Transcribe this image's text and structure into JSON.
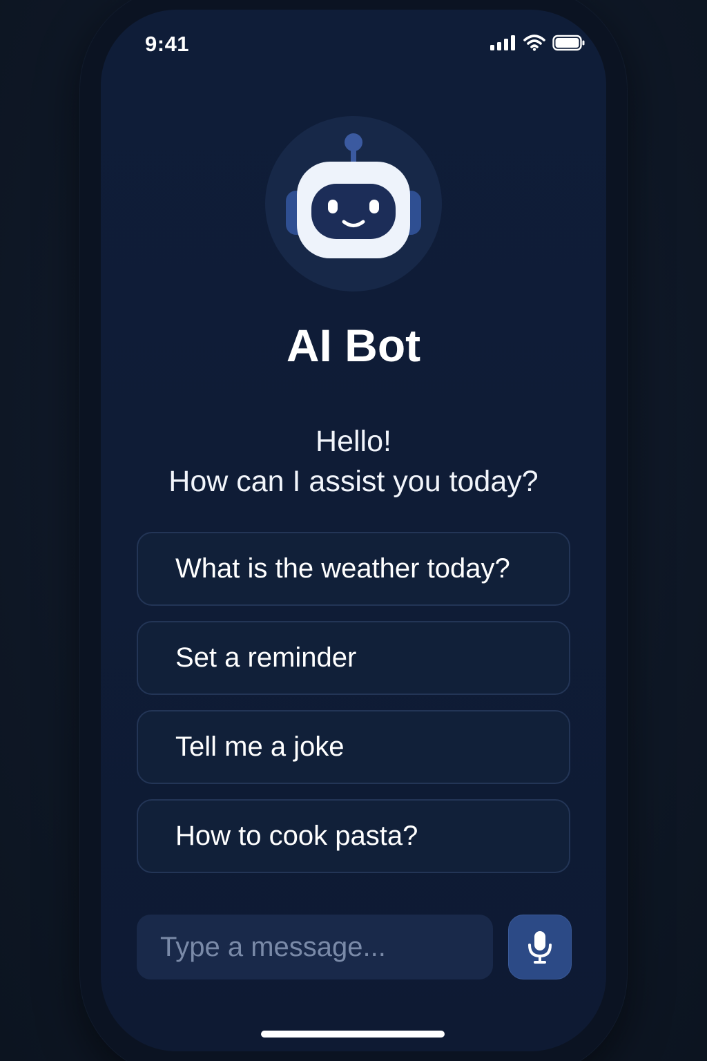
{
  "status_bar": {
    "time": "9:41",
    "icons": [
      "cellular-signal-icon",
      "wifi-icon",
      "battery-icon"
    ]
  },
  "bot": {
    "avatar_icon": "robot-icon",
    "name": "AI Bot",
    "greeting_line1": "Hello!",
    "greeting_line2": "How can I assist you today?"
  },
  "suggestions": [
    {
      "label": "What is the weather today?"
    },
    {
      "label": "Set a reminder"
    },
    {
      "label": "Tell me a joke"
    },
    {
      "label": "How to cook pasta?"
    }
  ],
  "composer": {
    "placeholder": "Type a message...",
    "mic_icon": "microphone-icon"
  },
  "colors": {
    "background": "#0f1c36",
    "accent": "#2c4a86",
    "text": "#ffffff"
  }
}
